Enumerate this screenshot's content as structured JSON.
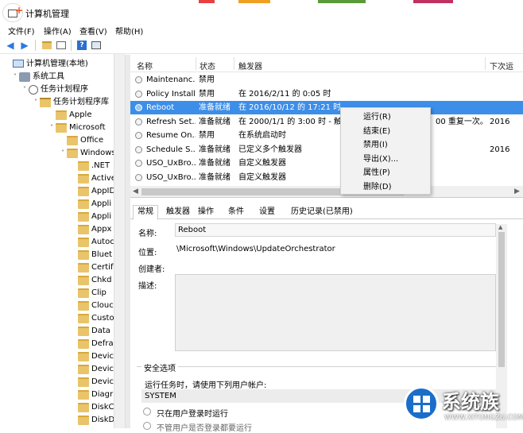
{
  "window": {
    "title": "计算机管理"
  },
  "menu": [
    "文件(F)",
    "操作(A)",
    "查看(V)",
    "帮助(H)"
  ],
  "tree": [
    {
      "label": "计算机管理(本地)",
      "level": 0,
      "icon": "computer-icon",
      "exp": ""
    },
    {
      "label": "系统工具",
      "level": 1,
      "icon": "tools-icon",
      "exp": "v"
    },
    {
      "label": "任务计划程序",
      "level": 2,
      "icon": "clock-icon",
      "exp": "v"
    },
    {
      "label": "任务计划程序库",
      "level": 3,
      "icon": "library-icon",
      "exp": "v"
    },
    {
      "label": "Apple",
      "level": 4,
      "icon": "folder-icon",
      "exp": ""
    },
    {
      "label": "Microsoft",
      "level": 4,
      "icon": "folder-icon",
      "exp": "v"
    },
    {
      "label": "Office",
      "level": 5,
      "icon": "folder-icon",
      "exp": ""
    },
    {
      "label": "Windows",
      "level": 5,
      "icon": "folder-icon",
      "exp": "v"
    },
    {
      "label": ".NET",
      "level": 6,
      "icon": "folder-icon",
      "exp": ""
    },
    {
      "label": "Active",
      "level": 6,
      "icon": "folder-icon",
      "exp": ""
    },
    {
      "label": "AppID",
      "level": 6,
      "icon": "folder-icon",
      "exp": ""
    },
    {
      "label": "Appli",
      "level": 6,
      "icon": "folder-icon",
      "exp": ""
    },
    {
      "label": "Appli",
      "level": 6,
      "icon": "folder-icon",
      "exp": ""
    },
    {
      "label": "Appx",
      "level": 6,
      "icon": "folder-icon",
      "exp": ""
    },
    {
      "label": "Autoc",
      "level": 6,
      "icon": "folder-icon",
      "exp": ""
    },
    {
      "label": "Bluet",
      "level": 6,
      "icon": "folder-icon",
      "exp": ""
    },
    {
      "label": "Certif",
      "level": 6,
      "icon": "folder-icon",
      "exp": ""
    },
    {
      "label": "Chkd",
      "level": 6,
      "icon": "folder-icon",
      "exp": ""
    },
    {
      "label": "Clip",
      "level": 6,
      "icon": "folder-icon",
      "exp": ""
    },
    {
      "label": "Clouc",
      "level": 6,
      "icon": "folder-icon",
      "exp": ""
    },
    {
      "label": "Custo",
      "level": 6,
      "icon": "folder-icon",
      "exp": ""
    },
    {
      "label": "Data",
      "level": 6,
      "icon": "folder-icon",
      "exp": ""
    },
    {
      "label": "Defra",
      "level": 6,
      "icon": "folder-icon",
      "exp": ""
    },
    {
      "label": "Devic",
      "level": 6,
      "icon": "folder-icon",
      "exp": ""
    },
    {
      "label": "Devic",
      "level": 6,
      "icon": "folder-icon",
      "exp": ""
    },
    {
      "label": "Devic",
      "level": 6,
      "icon": "folder-icon",
      "exp": ""
    },
    {
      "label": "Diagr",
      "level": 6,
      "icon": "folder-icon",
      "exp": ""
    },
    {
      "label": "DiskC",
      "level": 6,
      "icon": "folder-icon",
      "exp": ""
    },
    {
      "label": "DiskD",
      "level": 6,
      "icon": "folder-icon",
      "exp": ""
    }
  ],
  "task_list": {
    "columns": [
      "名称",
      "状态",
      "触发器",
      "下次运"
    ],
    "rows": [
      {
        "name": "Maintenanc...",
        "status": "禁用",
        "trigger": "",
        "next": ""
      },
      {
        "name": "Policy Install",
        "status": "禁用",
        "trigger": "在 2016/2/11 的 0:05 时",
        "next": ""
      },
      {
        "name": "Reboot",
        "status": "准备就绪",
        "trigger": "在 2016/10/12 的 17:21 时",
        "next": "",
        "selected": true
      },
      {
        "name": "Refresh Set...",
        "status": "准备就绪",
        "trigger": "在 2000/1/1 的 3:00 时 - 触发",
        "next": "2016",
        "extra": "00 重复一次。"
      },
      {
        "name": "Resume On...",
        "status": "禁用",
        "trigger": "在系统启动时",
        "next": ""
      },
      {
        "name": "Schedule S...",
        "status": "准备就绪",
        "trigger": "已定义多个触发器",
        "next": "2016"
      },
      {
        "name": "USO_UxBro...",
        "status": "准备就绪",
        "trigger": "自定义触发器",
        "next": ""
      },
      {
        "name": "USO_UxBro...",
        "status": "准备就绪",
        "trigger": "自定义触发器",
        "next": ""
      }
    ]
  },
  "context_menu": [
    "运行(R)",
    "结束(E)",
    "禁用(I)",
    "导出(X)...",
    "属性(P)",
    "删除(D)"
  ],
  "detail": {
    "tabs": [
      "常规",
      "触发器",
      "操作",
      "条件",
      "设置",
      "历史记录(已禁用)"
    ],
    "name_label": "名称:",
    "name_value": "Reboot",
    "location_label": "位置:",
    "location_value": "\\Microsoft\\Windows\\UpdateOrchestrator",
    "author_label": "创建者:",
    "desc_label": "描述:",
    "security_title": "安全选项",
    "run_as_label": "运行任务时，请使用下列用户帐户:",
    "run_as_value": "SYSTEM",
    "radio1": "只在用户登录时运行",
    "radio2": "不管用户是否登录都要运行"
  },
  "watermark": {
    "title": "系统族",
    "url": "WWW.XITONGZU.COM"
  }
}
